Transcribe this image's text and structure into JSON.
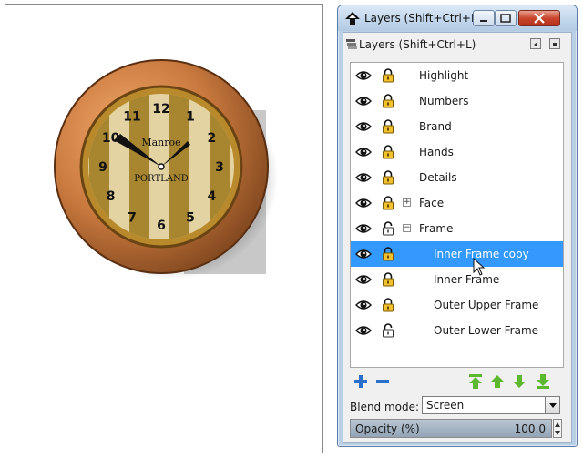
{
  "window": {
    "title": "Layers (Shift+Ctrl+L)"
  },
  "dock": {
    "title": "Layers (Shift+Ctrl+L)"
  },
  "layers": [
    {
      "name": "Highlight",
      "locked": true,
      "level": 0,
      "expander": ""
    },
    {
      "name": "Numbers",
      "locked": true,
      "level": 0,
      "expander": ""
    },
    {
      "name": "Brand",
      "locked": true,
      "level": 0,
      "expander": ""
    },
    {
      "name": "Hands",
      "locked": true,
      "level": 0,
      "expander": ""
    },
    {
      "name": "Details",
      "locked": true,
      "level": 0,
      "expander": ""
    },
    {
      "name": "Face",
      "locked": true,
      "level": 0,
      "expander": "+"
    },
    {
      "name": "Frame",
      "locked": false,
      "level": 0,
      "expander": "−"
    },
    {
      "name": "Inner Frame copy",
      "locked": true,
      "level": 1,
      "expander": "",
      "selected": true
    },
    {
      "name": "Inner Frame",
      "locked": true,
      "level": 1,
      "expander": ""
    },
    {
      "name": "Outer Upper Frame",
      "locked": true,
      "level": 1,
      "expander": ""
    },
    {
      "name": "Outer Lower Frame",
      "locked": false,
      "level": 1,
      "expander": ""
    }
  ],
  "blend": {
    "label": "Blend mode:",
    "value": "Screen"
  },
  "opacity": {
    "label": "Opacity (%)",
    "value": "100.0"
  },
  "clock": {
    "brand_top": "Manroe",
    "brand_bottom": "PORTLAND",
    "numbers": [
      "12",
      "1",
      "2",
      "3",
      "4",
      "5",
      "6",
      "7",
      "8",
      "9",
      "10",
      "11"
    ]
  },
  "colors": {
    "selection": "#3399ff",
    "accent_green": "#5cb82e",
    "accent_blue": "#2a6fc9"
  }
}
